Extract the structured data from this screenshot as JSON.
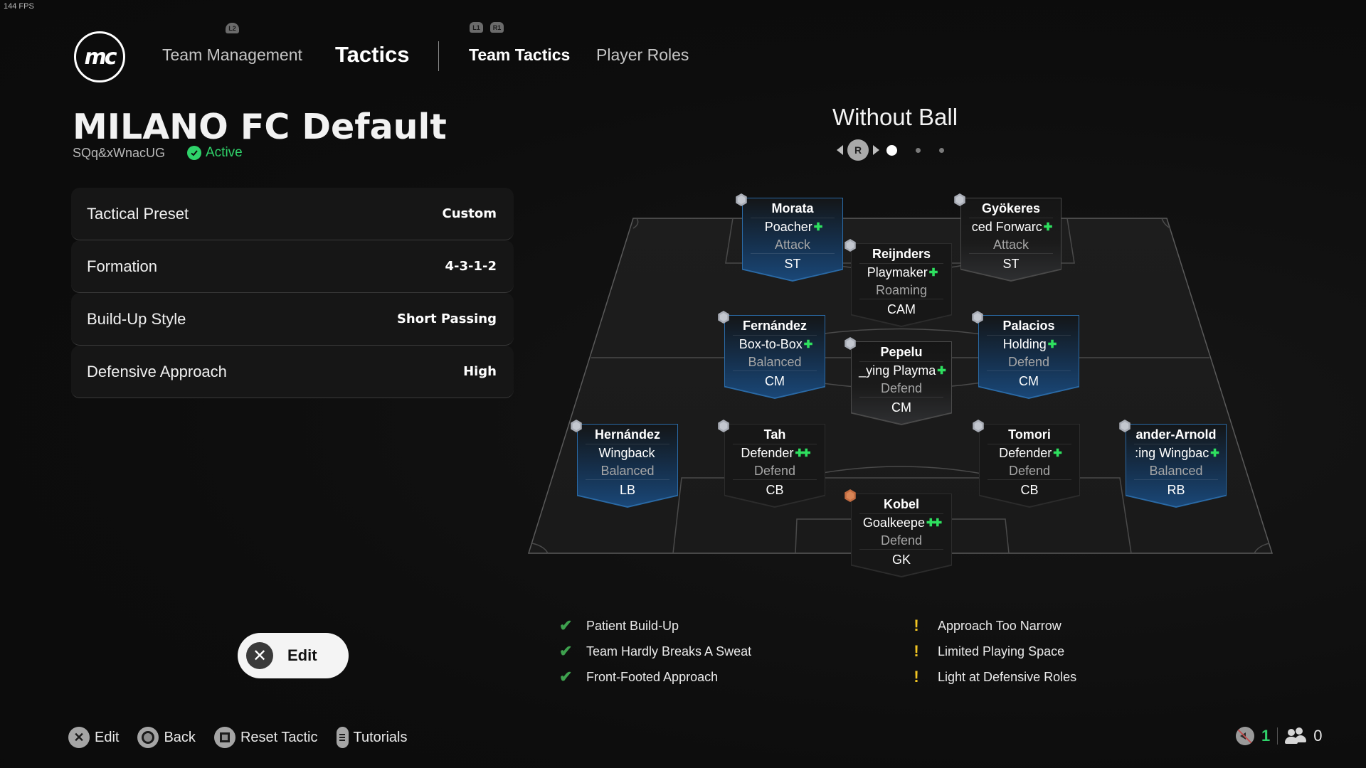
{
  "overlay": {
    "fps": "144 FPS"
  },
  "nav": {
    "logo_text": "mc",
    "trigger_left": "L2",
    "team_management": "Team Management",
    "tactics": "Tactics",
    "sub_trigger_left": "L1",
    "sub_trigger_right": "R1",
    "team_tactics": "Team Tactics",
    "player_roles": "Player Roles"
  },
  "tactic": {
    "name": "MILANO FC Default",
    "code": "SQq&xWnacUG",
    "status": "Active",
    "status_color": "#2fd36a"
  },
  "settings": [
    {
      "label": "Tactical Preset",
      "value": "Custom"
    },
    {
      "label": "Formation",
      "value": "4-3-1-2"
    },
    {
      "label": "Build-Up Style",
      "value": "Short Passing"
    },
    {
      "label": "Defensive Approach",
      "value": "High"
    }
  ],
  "view": {
    "title": "Without Ball",
    "stick_button": "R",
    "pages_total": 3,
    "page_current": 1
  },
  "players": [
    {
      "name": "Morata",
      "role": "Poacher",
      "plus": "+",
      "focus": "Attack",
      "position": "ST",
      "style": "blue",
      "hex": "silver"
    },
    {
      "name": "Gyökeres",
      "role": "ced Forwarc",
      "plus": "+",
      "focus": "Attack",
      "position": "ST",
      "style": "grey",
      "hex": "silver"
    },
    {
      "name": "Reijnders",
      "role": "Playmaker",
      "plus": "+",
      "focus": "Roaming",
      "position": "CAM",
      "style": "dark",
      "hex": "silver"
    },
    {
      "name": "Fernández",
      "role": "Box-to-Box",
      "plus": "+",
      "focus": "Balanced",
      "position": "CM",
      "style": "blue",
      "hex": "silver"
    },
    {
      "name": "Palacios",
      "role": "Holding",
      "plus": "+",
      "focus": "Defend",
      "position": "CM",
      "style": "blue",
      "hex": "silver"
    },
    {
      "name": "Pepelu",
      "role": "_ying Playma",
      "plus": "+",
      "focus": "Defend",
      "position": "CM",
      "style": "grey",
      "hex": "silver"
    },
    {
      "name": "Hernández",
      "role": "Wingback",
      "plus": "",
      "focus": "Balanced",
      "position": "LB",
      "style": "blue",
      "hex": "silver"
    },
    {
      "name": "Tah",
      "role": "Defender",
      "plus": "++",
      "focus": "Defend",
      "position": "CB",
      "style": "dark",
      "hex": "silver"
    },
    {
      "name": "Tomori",
      "role": "Defender",
      "plus": "+",
      "focus": "Defend",
      "position": "CB",
      "style": "dark",
      "hex": "silver"
    },
    {
      "name": "ander-Arnold",
      "role": ":ing Wingbac",
      "plus": "+",
      "focus": "Balanced",
      "position": "RB",
      "style": "blue",
      "hex": "silver"
    },
    {
      "name": "Kobel",
      "role": "Goalkeepe",
      "plus": "++",
      "focus": "Defend",
      "position": "GK",
      "style": "dark",
      "hex": "bronze"
    }
  ],
  "feedback": {
    "positives": [
      "Patient Build-Up",
      "Team Hardly Breaks A Sweat",
      "Front-Footed Approach"
    ],
    "warnings": [
      "Approach Too Narrow",
      "Limited Playing Space",
      "Light at Defensive Roles"
    ],
    "positive_color": "#3ea14e",
    "warning_color": "#f3c623"
  },
  "edit_button": {
    "glyph": "✕",
    "label": "Edit"
  },
  "footer": {
    "edit": "Edit",
    "back": "Back",
    "reset": "Reset Tactic",
    "tutorials": "Tutorials"
  },
  "status": {
    "mic_count": "1",
    "party_count": "0"
  }
}
